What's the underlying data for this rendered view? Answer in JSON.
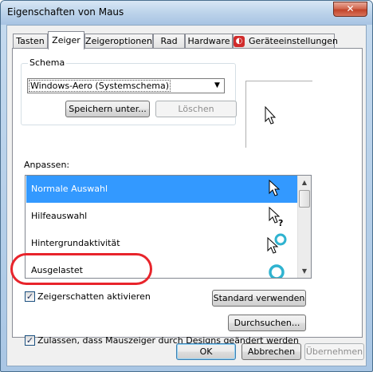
{
  "window": {
    "title": "Eigenschaften von Maus",
    "close_label": "✕"
  },
  "tabs": [
    {
      "label": "Tasten",
      "active": false
    },
    {
      "label": "Zeiger",
      "active": true
    },
    {
      "label": "Zeigeroptionen",
      "active": false
    },
    {
      "label": "Rad",
      "active": false
    },
    {
      "label": "Hardware",
      "active": false
    },
    {
      "label": "Geräteeinstellungen",
      "active": false,
      "icon": "synaptics-icon"
    }
  ],
  "schema": {
    "group_label": "Schema",
    "selected": "Windows-Aero (Systemschema)",
    "save_button": "Speichern unter...",
    "delete_button": "Löschen",
    "delete_enabled": false
  },
  "customize": {
    "label": "Anpassen:",
    "items": [
      {
        "label": "Normale Auswahl",
        "icon": "arrow-pointer-icon",
        "selected": true
      },
      {
        "label": "Hilfeauswahl",
        "icon": "help-pointer-icon",
        "selected": false
      },
      {
        "label": "Hintergrundaktivität",
        "icon": "working-in-background-icon",
        "selected": false
      },
      {
        "label": "Ausgelastet",
        "icon": "busy-ring-icon",
        "selected": false
      }
    ]
  },
  "options": {
    "shadow_checkbox": {
      "label": "Zeigerschatten aktivieren",
      "checked": true
    },
    "allow_themes_checkbox": {
      "label": "Zulassen, dass Mauszeiger durch Designs geändert werden",
      "checked": true
    },
    "default_button": "Standard verwenden",
    "browse_button": "Durchsuchen..."
  },
  "footer": {
    "ok": "OK",
    "cancel": "Abbrechen",
    "apply": "Übernehmen",
    "apply_enabled": false
  },
  "colors": {
    "selection": "#3399ff",
    "annotation": "#e8242b",
    "busy_ring": "#2fb3d0"
  }
}
